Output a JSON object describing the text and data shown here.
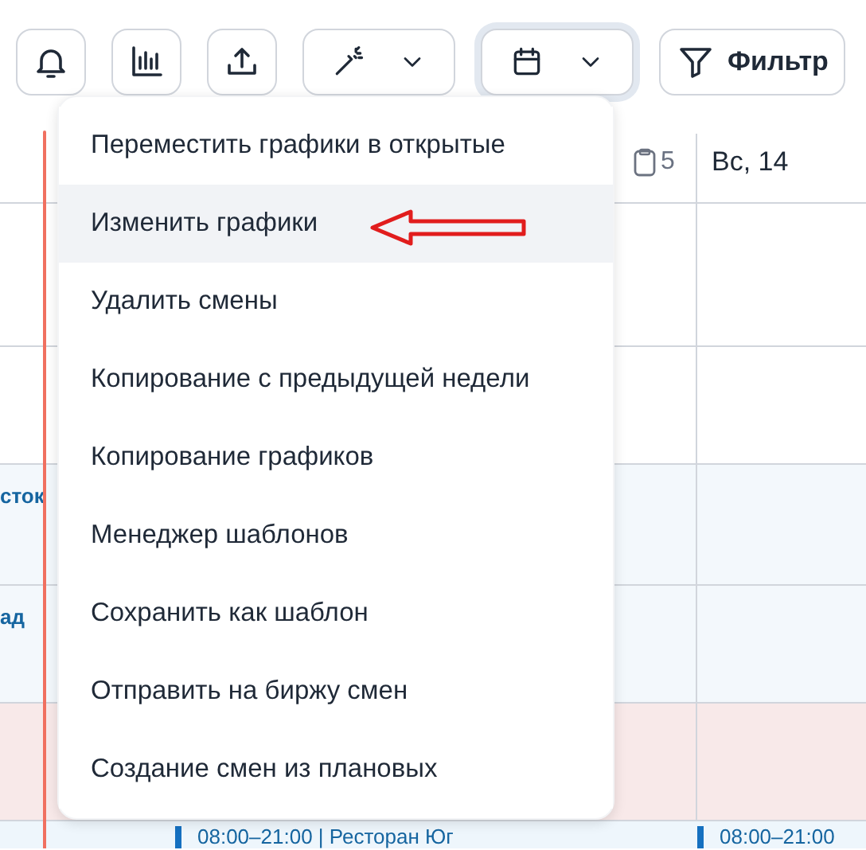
{
  "toolbar": [
    {
      "kind": "bell"
    },
    {
      "kind": "chart"
    },
    {
      "kind": "upload"
    },
    {
      "kind": "wand",
      "dropdown": true,
      "focused": false
    },
    {
      "kind": "calendar",
      "dropdown": true,
      "focused": true
    },
    {
      "kind": "filter",
      "label": "Фильтр"
    }
  ],
  "schedule": {
    "count": "5",
    "day": "Вс, 14",
    "rows": [
      {
        "kind": "plain"
      },
      {
        "kind": "plain"
      },
      {
        "kind": "shift",
        "left": "сток"
      },
      {
        "kind": "shift",
        "left": "ад"
      },
      {
        "kind": "closed"
      }
    ],
    "bottom": [
      "08:00–21:00 | Ресторан Юг",
      "08:00–21:00"
    ]
  },
  "menu": {
    "items": [
      {
        "label": "Переместить графики в открытые",
        "selected": false
      },
      {
        "label": "Изменить графики",
        "selected": true
      },
      {
        "label": "Удалить смены",
        "selected": false
      },
      {
        "label": "Копирование с предыдущей недели",
        "selected": false
      },
      {
        "label": "Копирование графиков",
        "selected": false
      },
      {
        "label": "Менеджер шаблонов",
        "selected": false
      },
      {
        "label": "Сохранить как шаблон",
        "selected": false
      },
      {
        "label": "Отправить на биржу смен",
        "selected": false
      },
      {
        "label": "Создание смен из плановых",
        "selected": false
      }
    ]
  }
}
